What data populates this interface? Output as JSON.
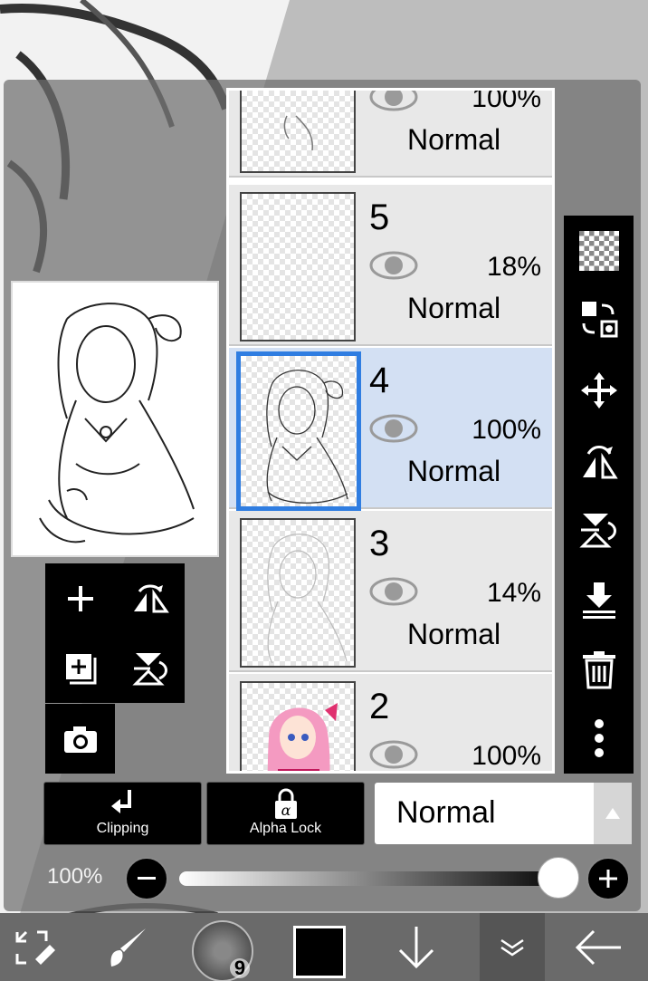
{
  "layers": [
    {
      "number": "",
      "opacity": "100%",
      "blend": "Normal",
      "visible": true,
      "selected": false,
      "partial": true
    },
    {
      "number": "5",
      "opacity": "18%",
      "blend": "Normal",
      "visible": true,
      "selected": false
    },
    {
      "number": "4",
      "opacity": "100%",
      "blend": "Normal",
      "visible": true,
      "selected": true
    },
    {
      "number": "3",
      "opacity": "14%",
      "blend": "Normal",
      "visible": true,
      "selected": false
    },
    {
      "number": "2",
      "opacity": "100%",
      "blend": "",
      "visible": true,
      "selected": false
    }
  ],
  "left_tools": {
    "icons": [
      "add-layer-icon",
      "flip-horizontal-icon",
      "add-copy-layer-icon",
      "flip-vertical-icon",
      "camera-icon"
    ]
  },
  "right_tools": {
    "icons": [
      "transparent-layer-icon",
      "swap-layer-icon",
      "move-icon",
      "flip-horizontal-icon",
      "flip-vertical-icon",
      "merge-down-icon",
      "trash-icon",
      "more-icon"
    ]
  },
  "controls": {
    "clipping_label": "Clipping",
    "alpha_lock_label": "Alpha Lock",
    "blend_mode": "Normal",
    "opacity_label": "100%",
    "opacity_value": 1.0
  },
  "bottom_bar": {
    "brush_size": "9",
    "color": "#000000",
    "icons": [
      "transform-icon",
      "brush-icon",
      "brush-size-icon",
      "color-swatch",
      "down-arrow-icon",
      "collapse-icon",
      "back-arrow-icon"
    ]
  },
  "colors": {
    "accent": "#2f7de1",
    "selected_bg": "#d3e0f3"
  }
}
